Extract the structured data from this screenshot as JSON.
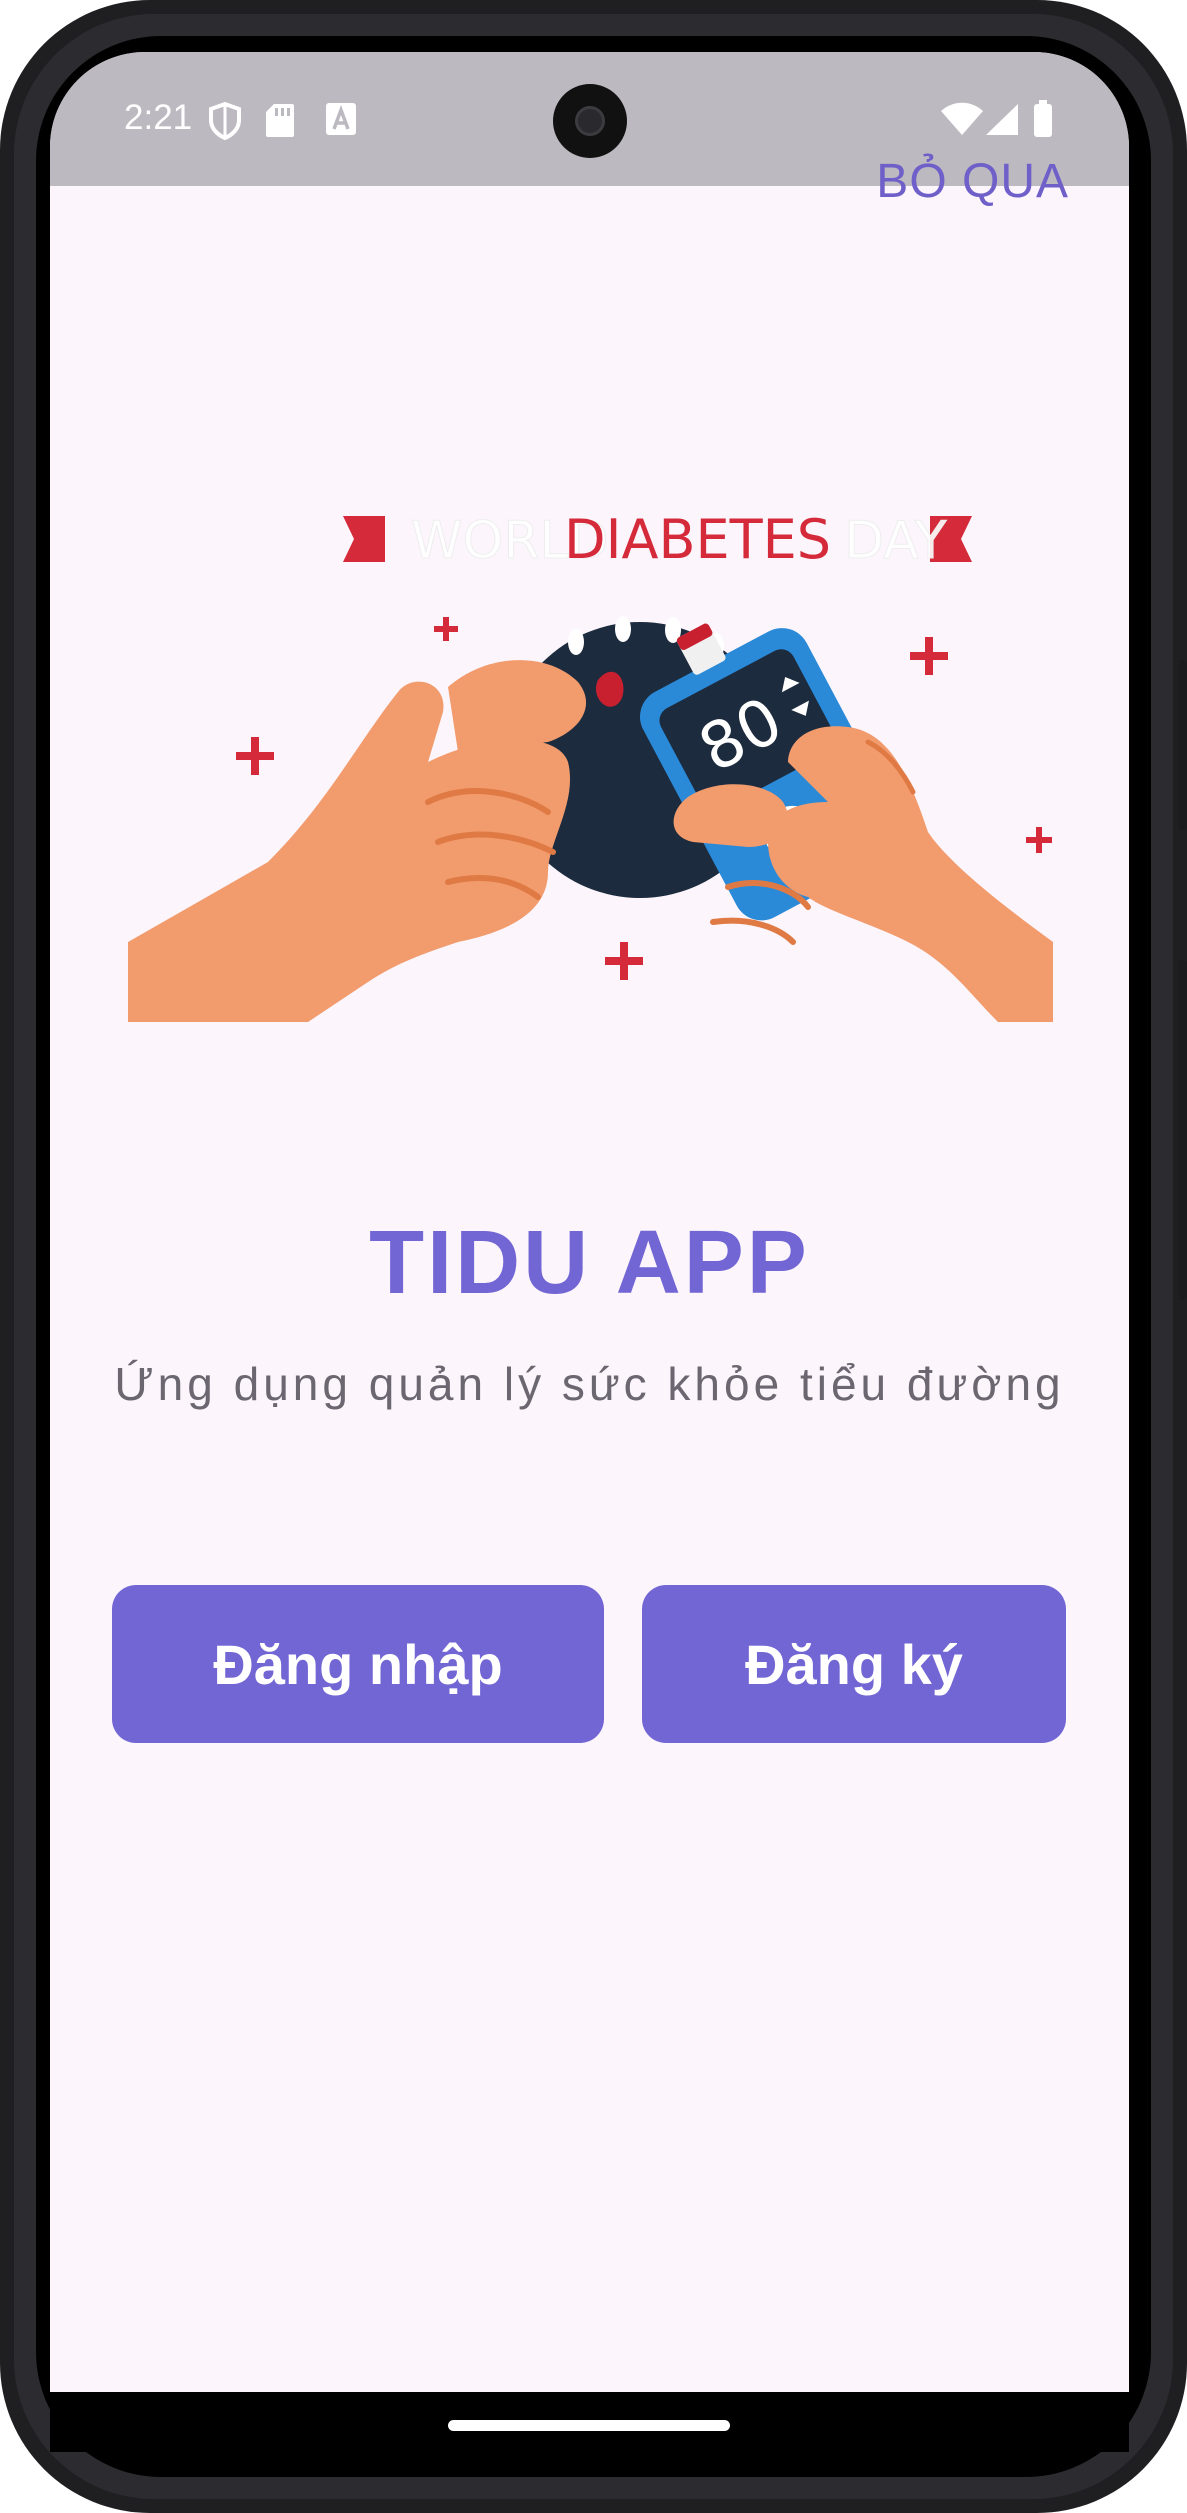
{
  "status_bar": {
    "time": "2:21",
    "left_icons": [
      "shield-icon",
      "sd-card-icon",
      "font-a-icon"
    ],
    "right_icons": [
      "wifi-icon",
      "signal-icon",
      "battery-icon"
    ]
  },
  "header": {
    "skip_label": "BỎ QUA"
  },
  "illustration": {
    "banner_text_1": "WORLD",
    "banner_text_2": "DIABETES",
    "banner_text_3": "DAY",
    "meter_reading": "80"
  },
  "main": {
    "title": "TIDU APP",
    "subtitle": "Ứng dụng quản lý sức khỏe tiểu đường",
    "login_label": "Đăng nhập",
    "register_label": "Đăng ký"
  },
  "colors": {
    "accent": "#7266d4",
    "background": "#fcf5fc",
    "status_bar": "#bdb9c0",
    "subtitle": "#6b6670"
  }
}
